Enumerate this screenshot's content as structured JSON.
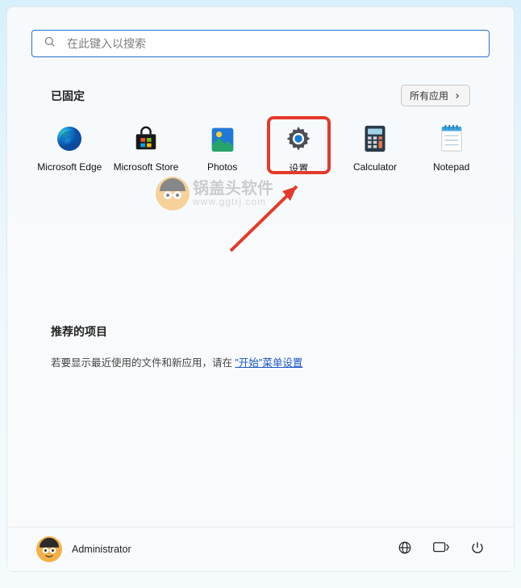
{
  "search": {
    "placeholder": "在此键入以搜索"
  },
  "pinned": {
    "title": "已固定",
    "all_apps_label": "所有应用",
    "items": [
      {
        "label": "Microsoft Edge",
        "icon": "edge-icon",
        "highlighted": false
      },
      {
        "label": "Microsoft Store",
        "icon": "store-icon",
        "highlighted": false
      },
      {
        "label": "Photos",
        "icon": "photos-icon",
        "highlighted": false
      },
      {
        "label": "设置",
        "icon": "settings-icon",
        "highlighted": true
      },
      {
        "label": "Calculator",
        "icon": "calculator-icon",
        "highlighted": false
      },
      {
        "label": "Notepad",
        "icon": "notepad-icon",
        "highlighted": false
      }
    ]
  },
  "watermark": {
    "text_big": "锅盖头软件",
    "text_small": "www.ggtrj.com"
  },
  "recommended": {
    "title": "推荐的项目",
    "prefix": "若要显示最近使用的文件和新应用，请在 ",
    "link": "\"开始\"菜单设置"
  },
  "footer": {
    "username": "Administrator"
  }
}
